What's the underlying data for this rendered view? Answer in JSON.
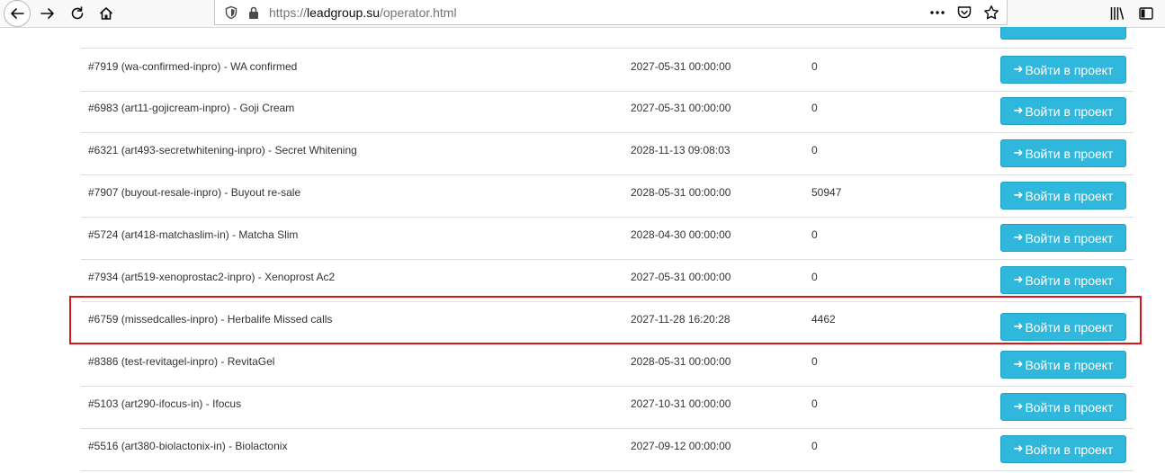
{
  "browser": {
    "url_scheme": "https://",
    "url_host": "leadgroup.su",
    "url_path": "/operator.html"
  },
  "icons": {
    "back": "back-arrow-icon",
    "forward": "forward-arrow-icon",
    "reload": "reload-icon",
    "home": "home-icon",
    "tracking": "shield-icon",
    "lock": "lock-icon",
    "more": "more-dots-icon",
    "pocket": "pocket-icon",
    "bookmark": "star-icon",
    "library": "library-icon",
    "sidebar": "sidebar-icon",
    "enter": "arrow-right-icon"
  },
  "colors": {
    "button_bg": "#2fb7dc",
    "highlight": "#d9141b"
  },
  "enter_label": "Войти в проект",
  "rows": [
    {
      "name": "#7919 (wa-confirmed-inpro) - WA confirmed",
      "date": "2027-05-31 00:00:00",
      "count": "0",
      "button": "Войти в проект"
    },
    {
      "name": "#6983 (art11-gojicream-inpro) - Goji Cream",
      "date": "2027-05-31 00:00:00",
      "count": "0",
      "button": "Войти в проект"
    },
    {
      "name": "#6321 (art493-secretwhitening-inpro) - Secret Whitening",
      "date": "2028-11-13 09:08:03",
      "count": "0",
      "button": "Войти в проект"
    },
    {
      "name": "#7907 (buyout-resale-inpro) - Buyout re-sale",
      "date": "2028-05-31 00:00:00",
      "count": "50947",
      "button": "Войти в проект"
    },
    {
      "name": "#5724 (art418-matchaslim-in) - Matcha Slim",
      "date": "2028-04-30 00:00:00",
      "count": "0",
      "button": "Войти в проект"
    },
    {
      "name": "#7934 (art519-xenoprostac2-inpro) - Xenoprost Ac2",
      "date": "2027-05-31 00:00:00",
      "count": "0",
      "button": "Войти в проект"
    },
    {
      "name": "#6759 (missedcalles-inpro) - Herbalife Missed calls",
      "date": "2027-11-28 16:20:28",
      "count": "4462",
      "button": "Войти в проект"
    },
    {
      "name": "#8386 (test-revitagel-inpro) - RevitaGel",
      "date": "2028-05-31 00:00:00",
      "count": "0",
      "button": "Войти в проект"
    },
    {
      "name": "#5103 (art290-ifocus-in) - Ifocus",
      "date": "2027-10-31 00:00:00",
      "count": "0",
      "button": "Войти в проект"
    },
    {
      "name": "#5516 (art380-biolactonix-in) - Biolactonix",
      "date": "2027-09-12 00:00:00",
      "count": "0",
      "button": "Войти в проект"
    }
  ]
}
